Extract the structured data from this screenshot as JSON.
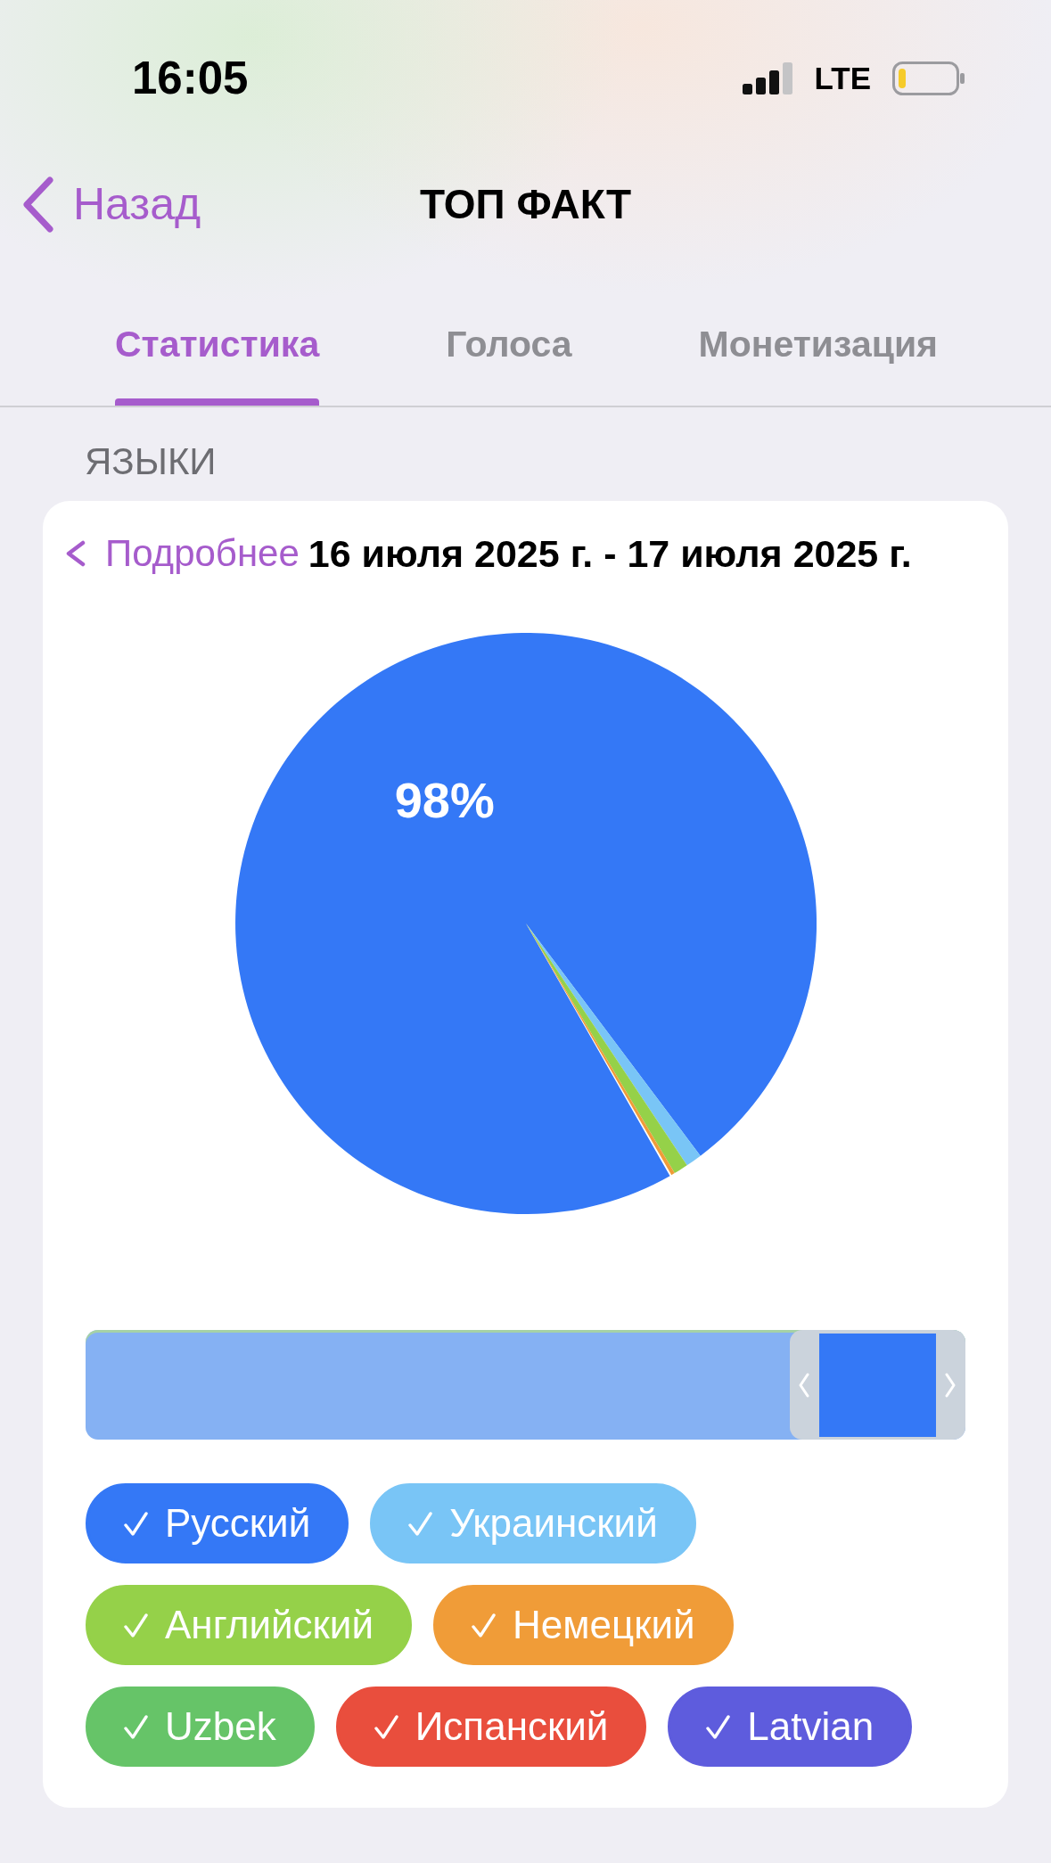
{
  "status_bar": {
    "time": "16:05",
    "network": "LTE"
  },
  "nav": {
    "back_label": "Назад",
    "title": "ТОП ФАКТ"
  },
  "tabs": [
    {
      "label": "Статистика",
      "selected": true
    },
    {
      "label": "Голоса",
      "selected": false
    },
    {
      "label": "Монетизация",
      "selected": false
    }
  ],
  "section_title": "ЯЗЫКИ",
  "card": {
    "details_link": "Подробнее",
    "date_range": "16 июля 2025 г. - 17 июля 2025 г.",
    "pie": {
      "label": "98%"
    },
    "range": {
      "start": {
        "level": 0.8
      },
      "end": {
        "level": 1.0
      }
    },
    "languages": [
      {
        "name": "Русский",
        "color": "#3478f6",
        "checked": true
      },
      {
        "name": "Украинский",
        "color": "#79c5f6",
        "checked": true
      },
      {
        "name": "Английский",
        "color": "#95d149",
        "checked": true
      },
      {
        "name": "Немецкий",
        "color": "#f09c38",
        "checked": true
      },
      {
        "name": "Uzbek",
        "color": "#66c468",
        "checked": true
      },
      {
        "name": "Испанский",
        "color": "#e94e3d",
        "checked": true
      },
      {
        "name": "Latvian",
        "color": "#5e5cdd",
        "checked": true
      }
    ]
  }
}
